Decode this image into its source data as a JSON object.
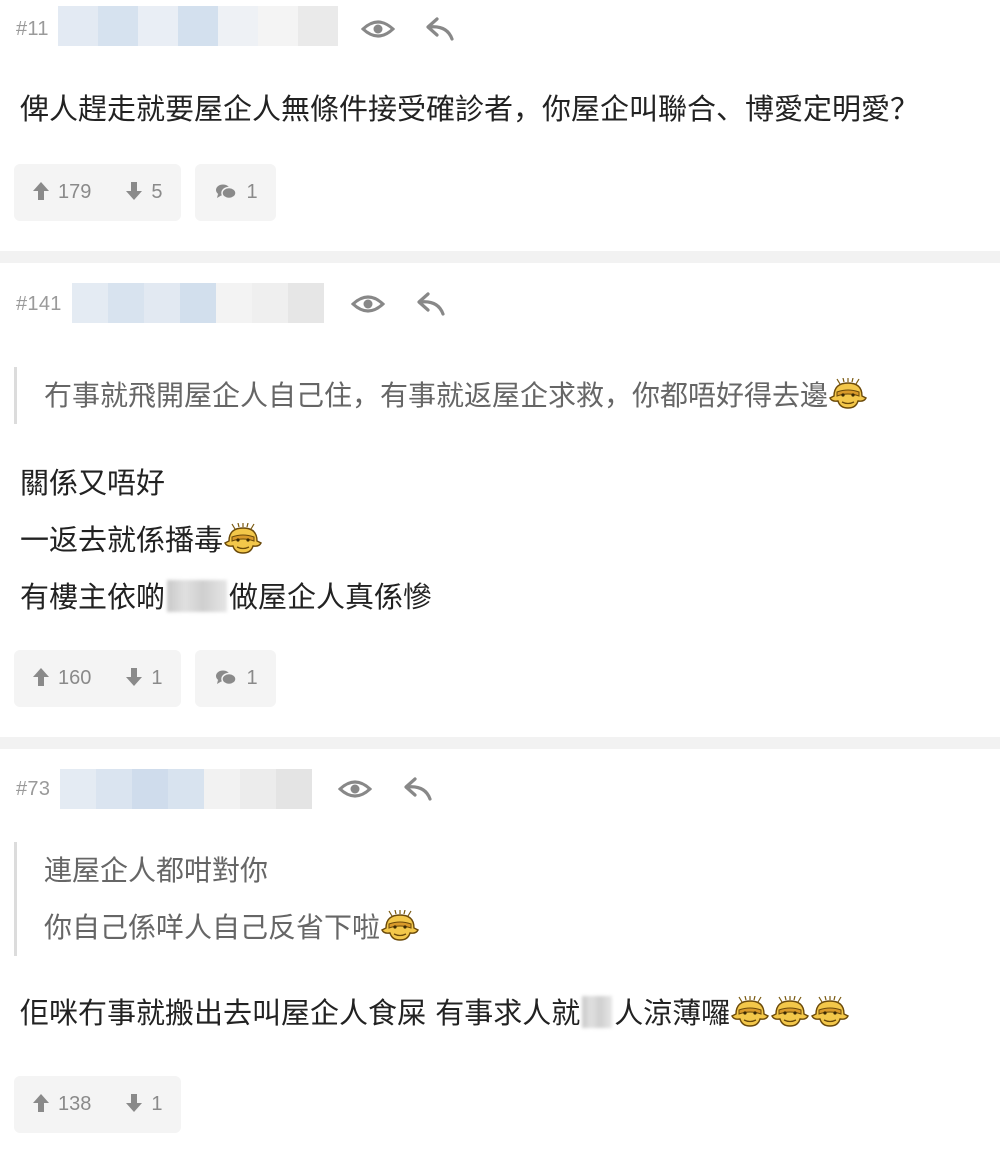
{
  "posts": [
    {
      "floor": "#11",
      "body_lines": [
        "俾人趕走就要屋企人無條件接受確診者，你屋企叫聯合、博愛定明愛？"
      ],
      "upvotes": "179",
      "downvotes": "5",
      "comments": "1"
    },
    {
      "floor": "#141",
      "quote_lines": [
        "冇事就飛開屋企人自己住，有事就返屋企求救，你都唔好得去邊"
      ],
      "body_lines": [
        "關係又唔好",
        "一返去就係播毒",
        "有樓主依啲",
        "做屋企人真係慘"
      ],
      "upvotes": "160",
      "downvotes": "1",
      "comments": "1"
    },
    {
      "floor": "#73",
      "quote_lines": [
        "連屋企人都咁對你",
        "你自己係咩人自己反省下啦"
      ],
      "body_lines": [
        "佢咪冇事就搬出去叫屋企人食屎 有事求人就",
        "人涼薄囉"
      ],
      "upvotes": "138",
      "downvotes": "1"
    }
  ],
  "icons": {
    "view": "eye-icon",
    "reply": "reply-icon",
    "upvote": "arrow-up-icon",
    "downvote": "arrow-down-icon",
    "comment": "comment-icon",
    "emoji": "smiley-emoji-icon"
  },
  "colors": {
    "text": "#222222",
    "quote_text": "#666666",
    "muted": "#9a9a9a",
    "button_bg": "#f4f4f4",
    "separator": "#f2f2f2"
  }
}
